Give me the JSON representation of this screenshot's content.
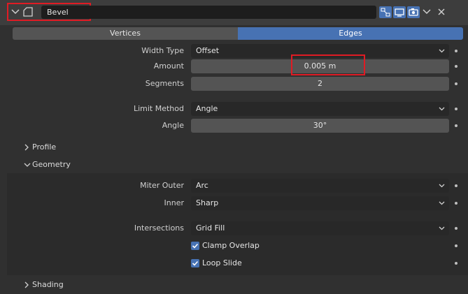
{
  "modifier": {
    "name": "Bevel",
    "icons": [
      "expand-chevron-icon",
      "bevel-modifier-icon",
      "edit-mode-icon",
      "realtime-display-icon",
      "render-camera-icon",
      "options-chevron-icon",
      "close-icon"
    ]
  },
  "tabs": {
    "vertices": "Vertices",
    "edges": "Edges",
    "active": "Edges"
  },
  "fields": {
    "width_type_label": "Width Type",
    "width_type_value": "Offset",
    "amount_label": "Amount",
    "amount_value": "0.005 m",
    "segments_label": "Segments",
    "segments_value": "2",
    "limit_method_label": "Limit Method",
    "limit_method_value": "Angle",
    "angle_label": "Angle",
    "angle_value": "30°"
  },
  "sections": {
    "profile": "Profile",
    "geometry": "Geometry",
    "shading": "Shading"
  },
  "geometry": {
    "miter_outer_label": "Miter Outer",
    "miter_outer_value": "Arc",
    "inner_label": "Inner",
    "inner_value": "Sharp",
    "intersections_label": "Intersections",
    "intersections_value": "Grid Fill",
    "clamp_overlap_label": "Clamp Overlap",
    "clamp_overlap_checked": true,
    "loop_slide_label": "Loop Slide",
    "loop_slide_checked": true
  },
  "colors": {
    "accent": "#4772b3",
    "highlight": "#e01b24",
    "panel": "#303030"
  }
}
